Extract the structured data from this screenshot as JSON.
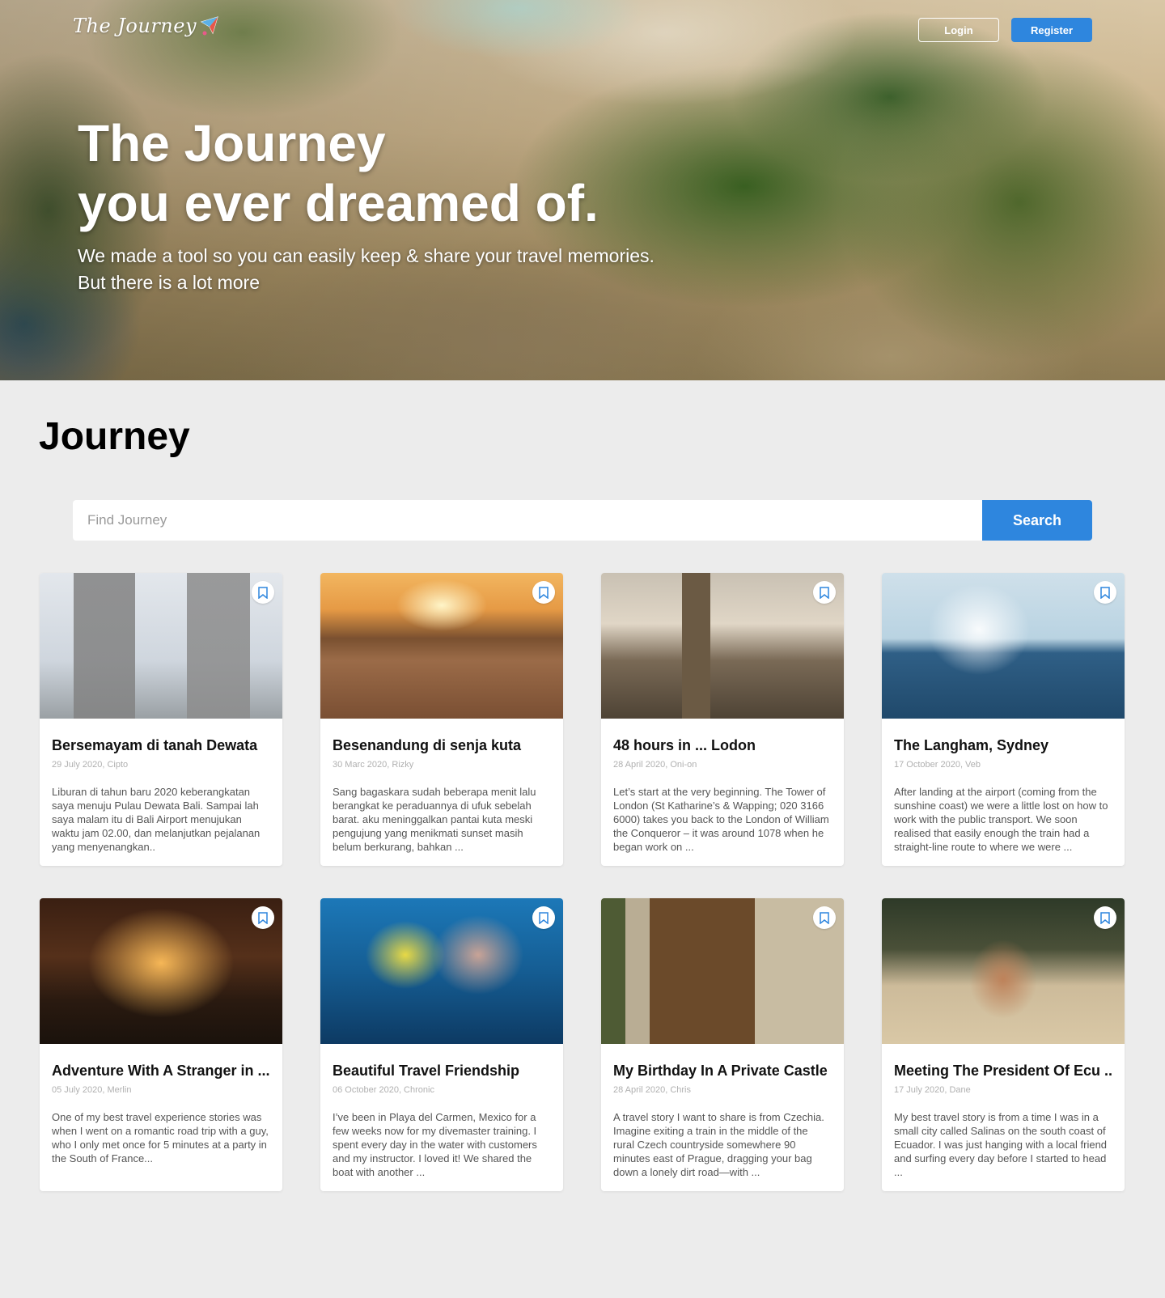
{
  "header": {
    "logo_text": "The Journey",
    "login_label": "Login",
    "register_label": "Register"
  },
  "hero": {
    "title_line1": "The Journey",
    "title_line2": "you ever dreamed of.",
    "subtitle_line1": "We made a tool so you can easily keep & share your travel memories.",
    "subtitle_line2": "But there is a lot more"
  },
  "main": {
    "section_title": "Journey",
    "search": {
      "placeholder": "Find Journey",
      "value": "",
      "button_label": "Search"
    },
    "cards": [
      {
        "title": "Bersemayam di tanah Dewata",
        "meta": "29 July 2020, Cipto",
        "description": "Liburan di tahun baru 2020 keberangkatan saya menuju Pulau Dewata Bali.  Sampai lah saya malam itu di Bali Airport menujukan waktu jam 02.00, dan melanjutkan pejalanan yang menyenangkan.."
      },
      {
        "title": "Besenandung di senja kuta",
        "meta": "30 Marc 2020, Rizky",
        "description": "Sang bagaskara sudah beberapa menit lalu berangkat ke peraduannya di ufuk sebelah barat. aku meninggalkan pantai kuta meski pengujung yang menikmati sunset masih belum berkurang, bahkan ..."
      },
      {
        "title": "48 hours in ... Lodon",
        "meta": "28 April 2020, Oni-on",
        "description": "Let’s start at the very beginning. The Tower of London (St Katharine’s & Wapping; 020 3166 6000) takes you back to the London of William the Conqueror – it was around 1078 when he began work on ..."
      },
      {
        "title": "The Langham, Sydney",
        "meta": "17 October 2020, Veb",
        "description": "After landing at the airport (coming from the sunshine coast) we were a little lost on how to work with the public transport. We soon realised that easily enough the train had a straight-line route to where we were ..."
      },
      {
        "title": "Adventure With A Stranger in ...",
        "meta": "05 July 2020, Merlin",
        "description": "One of my best travel experience stories was when I went on a romantic road trip with a guy, who I only met once for 5 minutes at a party in the South of France..."
      },
      {
        "title": "Beautiful Travel Friendship",
        "meta": "06 October 2020, Chronic",
        "description": "I’ve been in Playa del Carmen, Mexico for a few weeks now for my divemaster training. I spent every day in the water with customers and my instructor. I loved it! We shared the boat with another ..."
      },
      {
        "title": "My Birthday In A Private Castle ..",
        "meta": "28 April 2020, Chris",
        "description": "A travel story I want to share is from Czechia. Imagine exiting a train in the middle of the rural Czech countryside somewhere 90 minutes east of Prague, dragging your bag down a lonely dirt road—with ..."
      },
      {
        "title": "Meeting The President Of Ecu ...",
        "meta": "17 July 2020, Dane",
        "description": "My best travel story is from a time I was in a small city called Salinas on the south coast of Ecuador. I was just hanging with a local friend and surfing every day before I started to head ..."
      }
    ]
  },
  "colors": {
    "accent": "#2e86de",
    "page_background": "#ececec",
    "card_background": "#ffffff"
  },
  "icons": {
    "bookmark": "bookmark-icon",
    "logo": "paper-plane-map-icon"
  }
}
